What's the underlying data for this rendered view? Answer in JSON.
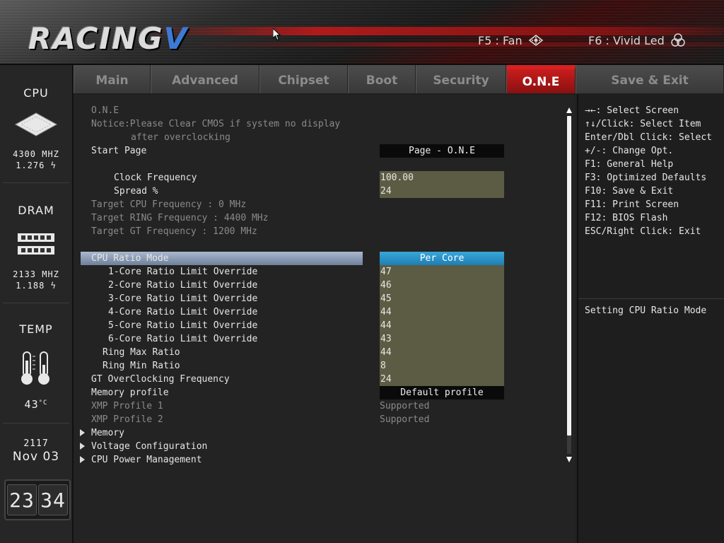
{
  "header": {
    "logo_text": "RACING",
    "logo_mark": "V",
    "f5_label": "F5 : Fan",
    "f6_label": "F6 : Vivid Led",
    "f5_icon": "fan-icon",
    "f6_icon": "led-icon"
  },
  "sidebar": {
    "cpu": {
      "title": "CPU",
      "freq": "4300 MHZ",
      "volt": "1.276"
    },
    "dram": {
      "title": "DRAM",
      "freq": "2133 MHZ",
      "volt": "1.188"
    },
    "temp": {
      "title": "TEMP",
      "value": "43"
    },
    "date": {
      "year": "2117",
      "day": "Nov 03"
    },
    "clock": {
      "hh": "23",
      "mm": "34"
    }
  },
  "tabs": [
    {
      "label": "Main"
    },
    {
      "label": "Advanced"
    },
    {
      "label": "Chipset"
    },
    {
      "label": "Boot"
    },
    {
      "label": "Security"
    },
    {
      "label": "O.N.E",
      "active": true
    },
    {
      "label": "Save & Exit"
    }
  ],
  "main": {
    "section_title": "O.N.E",
    "notice_line1": "Notice:Please Clear CMOS if system no display",
    "notice_line2": "after overclocking",
    "start_page": {
      "label": "Start Page",
      "value": "Page - O.N.E"
    },
    "clock_frequency": {
      "label": "Clock Frequency",
      "value": "100.00"
    },
    "spread": {
      "label": "Spread %",
      "value": "24"
    },
    "target_cpu": "Target CPU Frequency : 0 MHz",
    "target_ring": "Target RING Frequency : 4400 MHz",
    "target_gt": "Target GT Frequency : 1200 MHz",
    "cpu_ratio_mode": {
      "label": "CPU Ratio Mode",
      "value": "Per Core"
    },
    "core_limits": [
      {
        "label": "1-Core Ratio Limit Override",
        "value": "47"
      },
      {
        "label": "2-Core Ratio Limit Override",
        "value": "46"
      },
      {
        "label": "3-Core Ratio Limit Override",
        "value": "45"
      },
      {
        "label": "4-Core Ratio Limit Override",
        "value": "44"
      },
      {
        "label": "5-Core Ratio Limit Override",
        "value": "44"
      },
      {
        "label": "6-Core Ratio Limit Override",
        "value": "43"
      }
    ],
    "ring_max": {
      "label": "Ring Max Ratio",
      "value": "44"
    },
    "ring_min": {
      "label": "Ring Min Ratio",
      "value": "8"
    },
    "gt_oc": {
      "label": "GT OverClocking Frequency",
      "value": "24"
    },
    "memory_profile": {
      "label": "Memory profile",
      "value": "Default profile"
    },
    "xmp1": {
      "label": "XMP Profile 1",
      "value": "Supported"
    },
    "xmp2": {
      "label": "XMP Profile 2",
      "value": "Supported"
    },
    "submenus": [
      "Memory",
      "Voltage Configuration",
      "CPU Power Management"
    ]
  },
  "help": {
    "lines": [
      "→←: Select Screen",
      "↑↓/Click: Select Item",
      "Enter/Dbl Click: Select",
      "+/-: Change Opt.",
      "F1: General Help",
      "F3: Optimized Defaults",
      "F10: Save & Exit",
      "F11: Print Screen",
      "F12: BIOS Flash",
      "ESC/Right Click: Exit"
    ],
    "description": "Setting CPU Ratio Mode"
  },
  "colors": {
    "accent_red": "#c81d1d",
    "selected_value": "#2a95c9",
    "value_field": "#5c5c44"
  }
}
